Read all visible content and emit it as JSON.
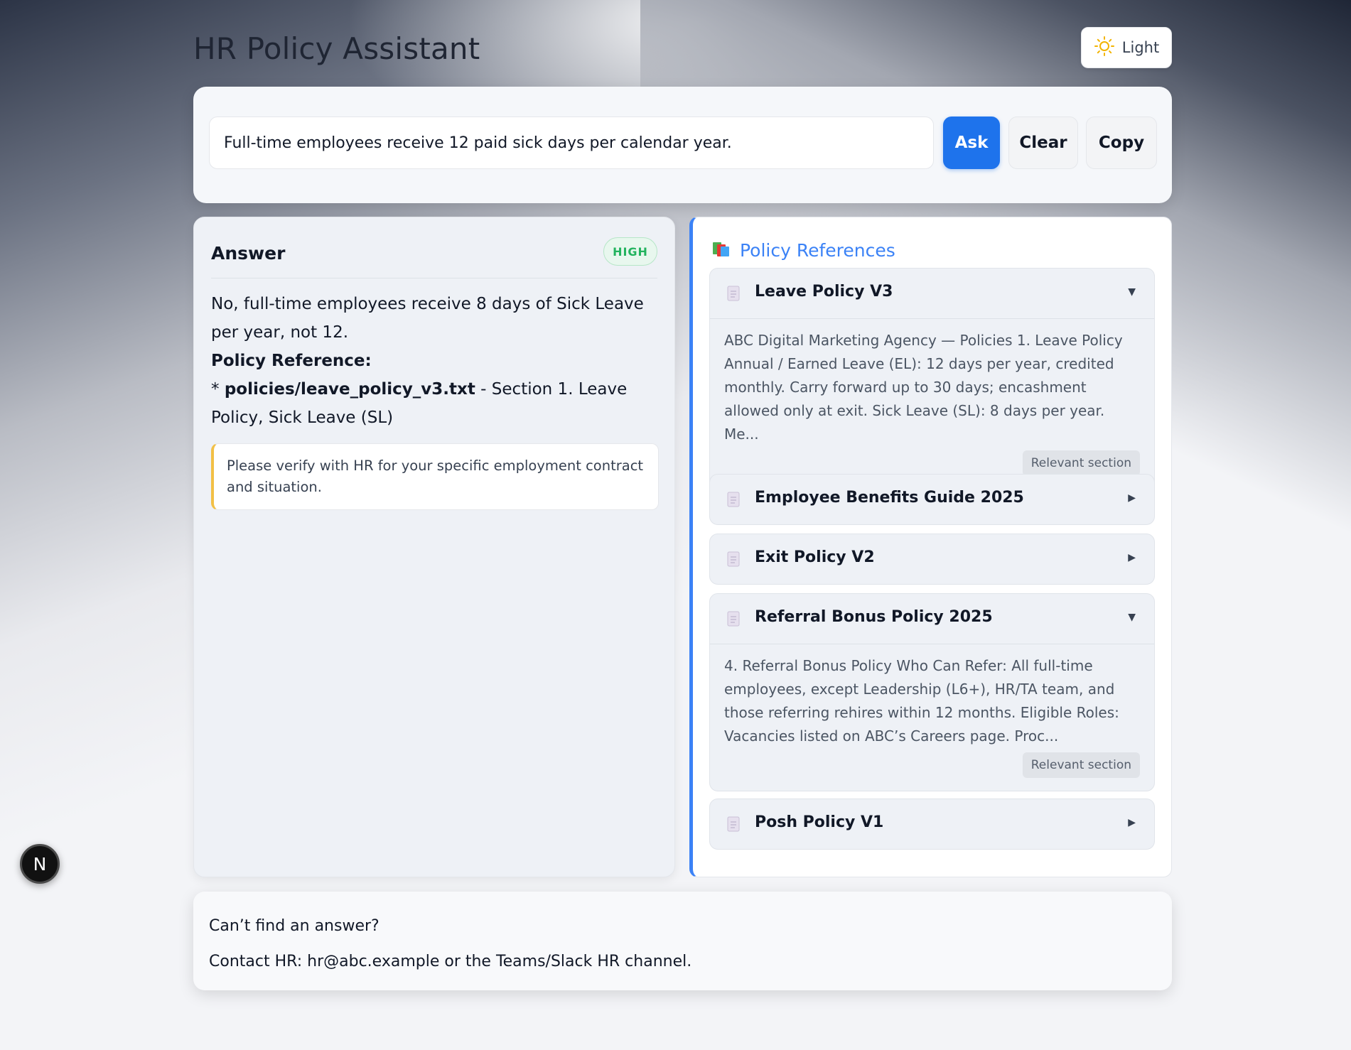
{
  "header": {
    "title": "HR Policy Assistant",
    "theme_label": "Light",
    "theme_icon": "sun-icon",
    "accent_color": "#f2b300"
  },
  "search": {
    "value": "Full-time employees receive 12 paid sick days per calendar year.",
    "ask_label": "Ask",
    "clear_label": "Clear",
    "copy_label": "Copy",
    "accent_color": "#1e73ec"
  },
  "answer": {
    "title": "Answer",
    "confidence": "HIGH",
    "text": "No, full-time employees receive 8 days of Sick Leave per year, not 12.",
    "policy_ref_label": "Policy Reference:",
    "ref_bullet": "* ",
    "ref_file": "policies/leave_policy_v3.txt",
    "ref_detail": " - Section 1. Leave Policy, Sick Leave (SL)",
    "verify_note": "Please verify with HR for your specific employment contract and situation."
  },
  "references": {
    "title": "Policy References",
    "title_icon": "books-icon",
    "relevant_label": "Relevant section",
    "items": [
      {
        "name": "Leave Policy V3",
        "expanded": true,
        "caret": "▼",
        "excerpt": "ABC Digital Marketing Agency — Policies 1. Leave Policy Annual / Earned Leave (EL): 12 days per year, credited monthly. Carry forward up to 30 days; encashment allowed only at exit. Sick Leave (SL): 8 days per year. Me..."
      },
      {
        "name": "Employee Benefits Guide 2025",
        "expanded": false,
        "caret": "▶"
      },
      {
        "name": "Exit Policy V2",
        "expanded": false,
        "caret": "▶"
      },
      {
        "name": "Referral Bonus Policy 2025",
        "expanded": true,
        "caret": "▼",
        "excerpt": "4. Referral Bonus Policy Who Can Refer: All full-time employees, except Leadership (L6+), HR/TA team, and those referring rehires within 12 months. Eligible Roles: Vacancies listed on ABC’s Careers page. Proc..."
      },
      {
        "name": "Posh Policy V1",
        "expanded": false,
        "caret": "▶"
      }
    ]
  },
  "footer": {
    "line1": "Can’t find an answer?",
    "line2": "Contact HR: hr@abc.example or the Teams/Slack HR channel."
  },
  "dev_badge": {
    "label": "N"
  }
}
